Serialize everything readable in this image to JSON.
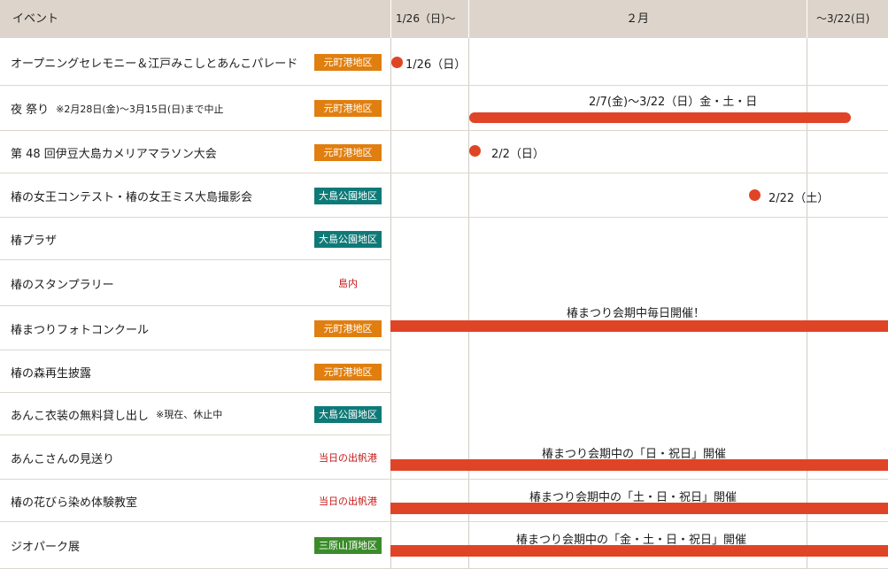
{
  "header": {
    "event_col": "イベント",
    "col1": "1/26（日)〜",
    "col2": "２月",
    "col3": "〜3/22(日)"
  },
  "colors": {
    "header_bg": "#ddd5cb",
    "bar": "#e04426",
    "area_motomachi": "#e07f10",
    "area_oshima_park": "#0e7a78",
    "area_mihara": "#3a8c2a",
    "red_text": "#c41818"
  },
  "rows": [
    {
      "name": "オープニングセレモニー＆江戸みこしとあんこパレード",
      "note": "",
      "area": "元町港地区",
      "area_style": "orange"
    },
    {
      "name": "夜 祭り",
      "note": "※2月28日(金)〜3月15日(日)まで中止",
      "area": "元町港地区",
      "area_style": "orange"
    },
    {
      "name": "第 48 回伊豆大島カメリアマラソン大会",
      "note": "",
      "area": "元町港地区",
      "area_style": "orange"
    },
    {
      "name": "椿の女王コンテスト・椿の女王ミス大島撮影会",
      "note": "",
      "area": "大島公園地区",
      "area_style": "teal"
    },
    {
      "name": "椿プラザ",
      "note": "",
      "area": "大島公園地区",
      "area_style": "teal"
    },
    {
      "name": "椿のスタンプラリー",
      "note": "",
      "area": "島内",
      "area_style": "plain"
    },
    {
      "name": "椿まつりフォトコンクール",
      "note": "",
      "area": "元町港地区",
      "area_style": "orange"
    },
    {
      "name": "椿の森再生披露",
      "note": "",
      "area": "元町港地区",
      "area_style": "orange"
    },
    {
      "name": "あんこ衣装の無料貸し出し",
      "note": "※現在、休止中",
      "area": "大島公園地区",
      "area_style": "teal"
    },
    {
      "name": "あんこさんの見送り",
      "note": "",
      "area": "当日の出帆港",
      "area_style": "plain"
    },
    {
      "name": "椿の花びら染め体験教室",
      "note": "",
      "area": "当日の出帆港",
      "area_style": "plain"
    },
    {
      "name": "ジオパーク展",
      "note": "",
      "area": "三原山頂地区",
      "area_style": "green"
    }
  ],
  "timeline": {
    "opening": "1/26（日）",
    "night_festival": "2/7(金)〜3/22（日）金・土・日",
    "marathon": "2/2（日）",
    "queen": "2/22（土）",
    "daily": "椿まつり会期中毎日開催！",
    "sun_holiday": "椿まつり会期中の「日・祝日」開催",
    "sat_sun_holiday": "椿まつり会期中の「土・日・祝日」開催",
    "fri_sat_sun_holiday": "椿まつり会期中の「金・土・日・祝日」開催"
  }
}
